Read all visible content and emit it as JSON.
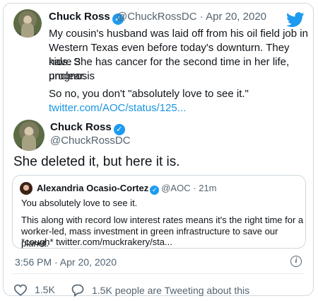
{
  "top_tweet": {
    "name": "Chuck Ross",
    "handle": "@ChuckRossDC",
    "separator": "·",
    "date": "Apr 20, 2020",
    "verified_mark": "✓",
    "lines": [
      "My cousin's husband was laid off from his oil field job in",
      "Western Texas even before today's downturn. They have 3",
      "kids. She has cancer for the second time in her life, prognosis",
      "unclear.",
      "So no, you don't \"absolutely love to see it.\""
    ],
    "link": "twitter.com/AOC/status/125..."
  },
  "main_tweet": {
    "name": "Chuck Ross",
    "handle": "@ChuckRossDC",
    "verified_mark": "✓",
    "text": "She deleted it, but here it is."
  },
  "quoted": {
    "name": "Alexandria Ocasio-Cortez",
    "handle": "@AOC",
    "separator": "·",
    "age": "21m",
    "verified_mark": "✓",
    "line1": "You absolutely love to see it.",
    "line2": "This along with record low interest rates means it's the right time for a",
    "line3": "worker-led, mass investment in green infrastructure to save our planet.",
    "line4": "*cough* twitter.com/muckrakery/sta..."
  },
  "footer": {
    "timestamp": "3:56 PM · Apr 20, 2020",
    "info_glyph": "i",
    "likes": "1.5K",
    "replies_text": "1.5K people are Tweeting about this"
  },
  "colors": {
    "accent": "#1d9bf0",
    "link": "#1b95e0",
    "muted": "#536471",
    "border": "#cfd9de"
  },
  "icons": [
    "twitter-bird-icon",
    "verified-badge-icon",
    "info-icon",
    "heart-icon",
    "speech-bubble-icon"
  ]
}
